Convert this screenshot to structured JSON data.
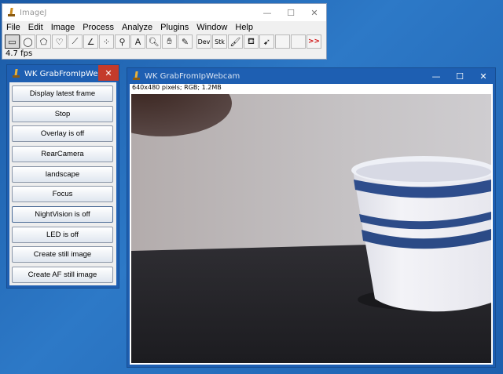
{
  "imagej": {
    "title": "ImageJ",
    "menus": [
      "File",
      "Edit",
      "Image",
      "Process",
      "Analyze",
      "Plugins",
      "Window",
      "Help"
    ],
    "tools": [
      {
        "name": "rectangle-tool",
        "glyph": "▭",
        "selected": true
      },
      {
        "name": "oval-tool",
        "glyph": "◯"
      },
      {
        "name": "polygon-tool",
        "glyph": "⬠"
      },
      {
        "name": "freehand-tool",
        "glyph": "♡"
      },
      {
        "name": "line-tool",
        "glyph": "⟋"
      },
      {
        "name": "angle-tool",
        "glyph": "∠"
      },
      {
        "name": "multipoint-tool",
        "glyph": "⁘"
      },
      {
        "name": "wand-tool",
        "glyph": "⚲"
      },
      {
        "name": "text-tool",
        "glyph": "A"
      },
      {
        "name": "magnifier-tool",
        "glyph": "🔍︎"
      },
      {
        "name": "hand-tool",
        "glyph": "✋︎"
      },
      {
        "name": "color-picker-tool",
        "glyph": "✎"
      },
      {
        "name": "dev-tool",
        "glyph": "Dev"
      },
      {
        "name": "stk-tool",
        "glyph": "Stk"
      },
      {
        "name": "brush-tool",
        "glyph": "🖌︎"
      },
      {
        "name": "flood-fill-tool",
        "glyph": "⛾"
      },
      {
        "name": "arrow-tool",
        "glyph": "➹"
      },
      {
        "name": "blank-tool-1",
        "glyph": ""
      },
      {
        "name": "blank-tool-2",
        "glyph": ""
      },
      {
        "name": "more-tools",
        "glyph": ">>"
      }
    ],
    "status": "4.7 fps"
  },
  "panel": {
    "title": "WK GrabFromIpWebc...",
    "buttons": [
      "Display latest frame",
      "Stop",
      "Overlay is off",
      "RearCamera",
      "landscape",
      "Focus",
      "NightVision is off",
      "LED is off",
      "Create still image",
      "Create AF still image"
    ]
  },
  "image_window": {
    "title": "WK GrabFromIpWebcam",
    "info": "640x480 pixels; RGB; 1.2MB"
  },
  "controls": {
    "minimize": "—",
    "maximize": "☐",
    "close": "✕"
  }
}
